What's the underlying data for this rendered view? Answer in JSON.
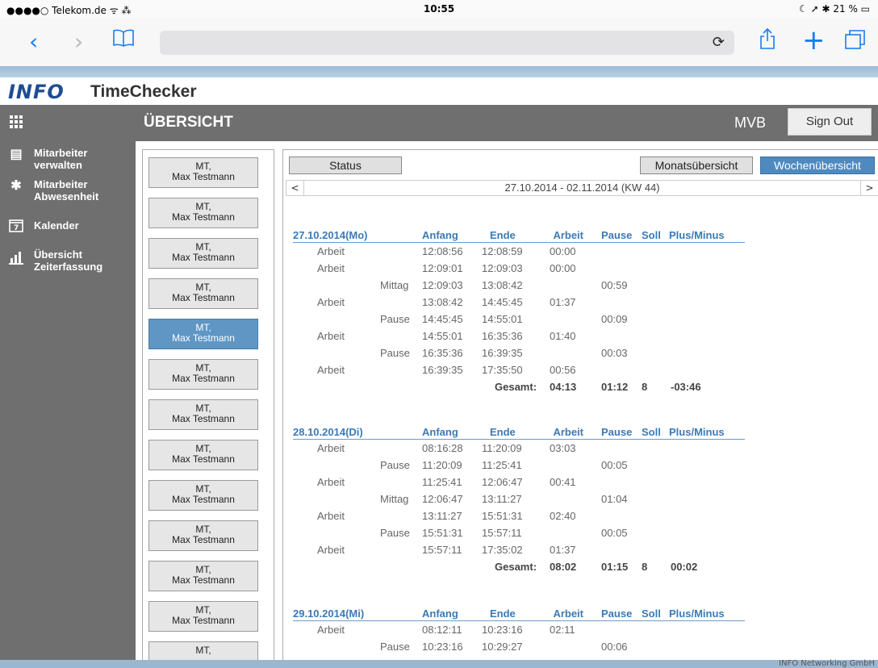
{
  "status_bar": {
    "carrier": "●●●●○ Telekom.de ᯤ ⁂",
    "time": "10:55",
    "battery": "☾ ➚ ✱ 21 % ▭"
  },
  "safari": {
    "reload_icon": "reload-icon"
  },
  "app": {
    "logo": "INFO",
    "title": "TimeChecker"
  },
  "topbar": {
    "page_title": "ÜBERSICHT",
    "user": "MVB",
    "sign_out": "Sign Out"
  },
  "sidebar": {
    "items": [
      {
        "label": "Mitarbeiter verwalten",
        "icon": "id-card-icon"
      },
      {
        "label": "Mitarbeiter Abwesenheit",
        "icon": "gear-icon"
      },
      {
        "label": "Kalender",
        "icon": "calendar-icon"
      },
      {
        "label": "Übersicht Zeiterfassung",
        "icon": "bar-chart-icon"
      }
    ]
  },
  "employees": [
    {
      "line1": "MT,",
      "line2": "Max Testmann"
    },
    {
      "line1": "MT,",
      "line2": "Max Testmann"
    },
    {
      "line1": "MT,",
      "line2": "Max Testmann"
    },
    {
      "line1": "MT,",
      "line2": "Max Testmann"
    },
    {
      "line1": "MT,",
      "line2": "Max Testmann"
    },
    {
      "line1": "MT,",
      "line2": "Max Testmann"
    },
    {
      "line1": "MT,",
      "line2": "Max Testmann"
    },
    {
      "line1": "MT,",
      "line2": "Max Testmann"
    },
    {
      "line1": "MT,",
      "line2": "Max Testmann"
    },
    {
      "line1": "MT,",
      "line2": "Max Testmann"
    },
    {
      "line1": "MT,",
      "line2": "Max Testmann"
    },
    {
      "line1": "MT,",
      "line2": "Max Testmann"
    },
    {
      "line1": "MT,",
      "line2": ""
    }
  ],
  "toolbar": {
    "status": "Status",
    "monthly": "Monatsübersicht",
    "weekly": "Wochenübersicht"
  },
  "range": {
    "prev": "<",
    "label": "27.10.2014 - 02.11.2014 (KW 44)",
    "next": ">"
  },
  "columns": {
    "anfang": "Anfang",
    "ende": "Ende",
    "arbeit": "Arbeit",
    "pause": "Pause",
    "soll": "Soll",
    "plusminus": "Plus/Minus"
  },
  "days": [
    {
      "date": "27.10.2014(Mo)",
      "rows": [
        {
          "typ": "Arbeit",
          "sub": "",
          "anfang": "12:08:56",
          "ende": "12:08:59",
          "arbeit": "00:00",
          "pause": ""
        },
        {
          "typ": "Arbeit",
          "sub": "",
          "anfang": "12:09:01",
          "ende": "12:09:03",
          "arbeit": "00:00",
          "pause": ""
        },
        {
          "typ": "",
          "sub": "Mittag",
          "anfang": "12:09:03",
          "ende": "13:08:42",
          "arbeit": "",
          "pause": "00:59"
        },
        {
          "typ": "Arbeit",
          "sub": "",
          "anfang": "13:08:42",
          "ende": "14:45:45",
          "arbeit": "01:37",
          "pause": ""
        },
        {
          "typ": "",
          "sub": "Pause",
          "anfang": "14:45:45",
          "ende": "14:55:01",
          "arbeit": "",
          "pause": "00:09"
        },
        {
          "typ": "Arbeit",
          "sub": "",
          "anfang": "14:55:01",
          "ende": "16:35:36",
          "arbeit": "01:40",
          "pause": ""
        },
        {
          "typ": "",
          "sub": "Pause",
          "anfang": "16:35:36",
          "ende": "16:39:35",
          "arbeit": "",
          "pause": "00:03"
        },
        {
          "typ": "Arbeit",
          "sub": "",
          "anfang": "16:39:35",
          "ende": "17:35:50",
          "arbeit": "00:56",
          "pause": ""
        }
      ],
      "total": {
        "label": "Gesamt:",
        "arbeit": "04:13",
        "pause": "01:12",
        "soll": "8",
        "pm": "-03:46"
      }
    },
    {
      "date": "28.10.2014(Di)",
      "rows": [
        {
          "typ": "Arbeit",
          "sub": "",
          "anfang": "08:16:28",
          "ende": "11:20:09",
          "arbeit": "03:03",
          "pause": ""
        },
        {
          "typ": "",
          "sub": "Pause",
          "anfang": "11:20:09",
          "ende": "11:25:41",
          "arbeit": "",
          "pause": "00:05"
        },
        {
          "typ": "Arbeit",
          "sub": "",
          "anfang": "11:25:41",
          "ende": "12:06:47",
          "arbeit": "00:41",
          "pause": ""
        },
        {
          "typ": "",
          "sub": "Mittag",
          "anfang": "12:06:47",
          "ende": "13:11:27",
          "arbeit": "",
          "pause": "01:04"
        },
        {
          "typ": "Arbeit",
          "sub": "",
          "anfang": "13:11:27",
          "ende": "15:51:31",
          "arbeit": "02:40",
          "pause": ""
        },
        {
          "typ": "",
          "sub": "Pause",
          "anfang": "15:51:31",
          "ende": "15:57:11",
          "arbeit": "",
          "pause": "00:05"
        },
        {
          "typ": "Arbeit",
          "sub": "",
          "anfang": "15:57:11",
          "ende": "17:35:02",
          "arbeit": "01:37",
          "pause": ""
        }
      ],
      "total": {
        "label": "Gesamt:",
        "arbeit": "08:02",
        "pause": "01:15",
        "soll": "8",
        "pm": "00:02"
      }
    },
    {
      "date": "29.10.2014(Mi)",
      "rows": [
        {
          "typ": "Arbeit",
          "sub": "",
          "anfang": "08:12:11",
          "ende": "10:23:16",
          "arbeit": "02:11",
          "pause": ""
        },
        {
          "typ": "",
          "sub": "Pause",
          "anfang": "10:23:16",
          "ende": "10:29:27",
          "arbeit": "",
          "pause": "00:06"
        }
      ]
    }
  ],
  "footer": "INFO Networking GmbH",
  "colors": {
    "accent": "#4e8ac0",
    "sidebar": "#6f6f6f",
    "heading": "#3b7ab5"
  }
}
